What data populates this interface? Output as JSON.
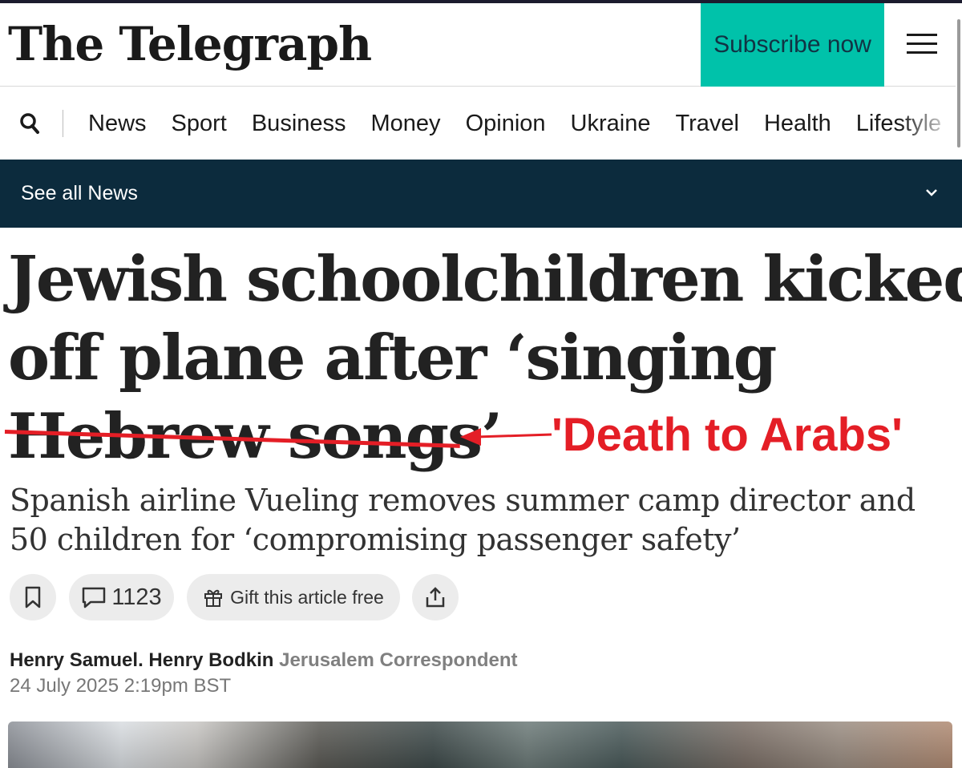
{
  "header": {
    "logo": "The Telegraph",
    "subscribe_label": "Subscribe now"
  },
  "nav": {
    "items": [
      "News",
      "Sport",
      "Business",
      "Money",
      "Opinion",
      "Ukraine",
      "Travel",
      "Health",
      "Lifestyle"
    ]
  },
  "section_bar": {
    "label": "See all News"
  },
  "article": {
    "headline_lines": [
      "Jewish schoolchildren kicked",
      "off plane after ‘singing",
      "Hebrew songs’"
    ],
    "annotation": "'Death to Arabs'",
    "standfirst_lines": [
      "Spanish airline Vueling removes summer camp director and",
      "50 children for ‘compromising passenger safety’"
    ],
    "comment_count": "1123",
    "gift_label": "Gift this article free",
    "authors": [
      "Henry Samuel.",
      "Henry Bodkin"
    ],
    "author_role": "Jerusalem Correspondent",
    "date": "24 July 2025 2:19pm BST"
  },
  "colors": {
    "subscribe_bg": "#00c2aa",
    "section_bar_bg": "#0c2b3d",
    "annotation_red": "#e41e26"
  },
  "icons": {
    "search": "search-icon",
    "menu": "hamburger-menu-icon",
    "chevron": "chevron-down-icon",
    "bookmark": "bookmark-icon",
    "comment": "comment-icon",
    "gift": "gift-icon",
    "share": "share-icon"
  }
}
